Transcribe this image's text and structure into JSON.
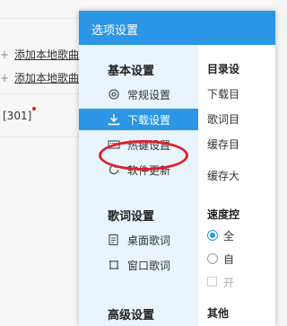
{
  "background": {
    "add_local_1": "添加本地歌曲",
    "add_local_2": "添加本地歌曲",
    "tag_301": "[301]"
  },
  "dialog": {
    "title": "选项设置",
    "sections": [
      {
        "title": "基本设置",
        "items": [
          {
            "label": "常规设置",
            "icon": "gear-icon"
          },
          {
            "label": "下载设置",
            "icon": "download-icon",
            "active": true
          },
          {
            "label": "热键设置",
            "icon": "keyboard-icon"
          },
          {
            "label": "软件更新",
            "icon": "refresh-icon"
          }
        ]
      },
      {
        "title": "歌词设置",
        "items": [
          {
            "label": "桌面歌词",
            "icon": "desktop-lyrics-icon"
          },
          {
            "label": "窗口歌词",
            "icon": "window-lyrics-icon"
          }
        ]
      },
      {
        "title": "高级设置",
        "items": []
      }
    ],
    "main": {
      "dir_header": "目录设",
      "download_dir": "下载目",
      "lyrics_dir": "歌词目",
      "cache_dir": "缓存目",
      "cache_size": "缓存大",
      "speed_header": "速度控",
      "speed_opt1": "全",
      "speed_opt2": "自",
      "speed_opt3": "开",
      "other": "其他"
    },
    "colors": {
      "accent": "#2b96e6",
      "highlight_circle": "#e0202a"
    }
  }
}
